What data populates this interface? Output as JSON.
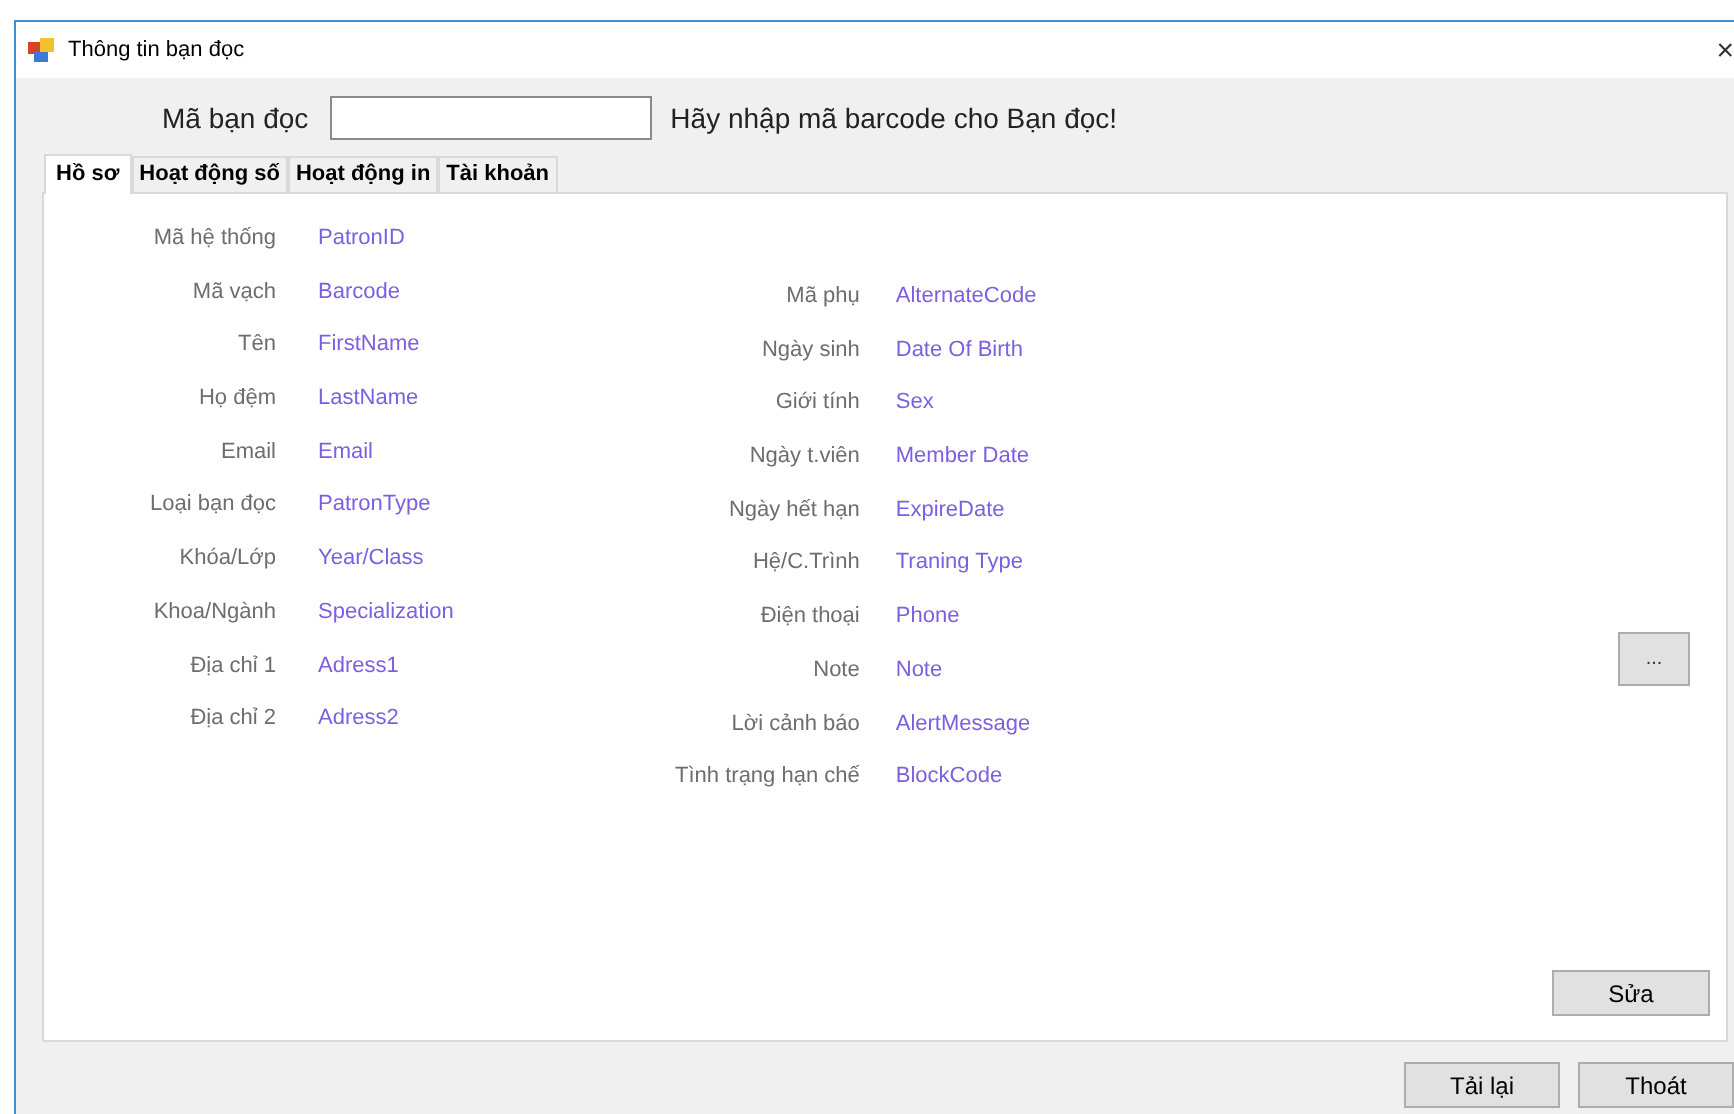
{
  "window": {
    "title": "Thông tin bạn đọc",
    "close": "×"
  },
  "lookup": {
    "label": "Mã bạn đọc",
    "hint": "Hãy nhập mã barcode cho Bạn đọc!"
  },
  "tabs": [
    {
      "label": "Hồ sơ",
      "selected": true
    },
    {
      "label": "Hoạt động số",
      "selected": false
    },
    {
      "label": "Hoạt động in",
      "selected": false
    },
    {
      "label": "Tài khoản",
      "selected": false
    }
  ],
  "left_fields": [
    {
      "label": "Mã hệ thống",
      "value": "PatronID"
    },
    {
      "label": "Mã vạch",
      "value": "Barcode"
    },
    {
      "label": "Tên",
      "value": "FirstName"
    },
    {
      "label": "Họ đệm",
      "value": "LastName"
    },
    {
      "label": "Email",
      "value": "Email"
    },
    {
      "label": "Loại bạn đọc",
      "value": "PatronType"
    },
    {
      "label": "Khóa/Lớp",
      "value": "Year/Class"
    },
    {
      "label": "Khoa/Ngành",
      "value": "Specialization"
    },
    {
      "label": "Địa chỉ 1",
      "value": "Adress1"
    },
    {
      "label": "Địa chỉ 2",
      "value": "Adress2"
    }
  ],
  "right_fields": [
    {
      "label": "Mã phụ",
      "value": "AlternateCode"
    },
    {
      "label": "Ngày sinh",
      "value": "Date Of Birth"
    },
    {
      "label": "Giới tính",
      "value": "Sex"
    },
    {
      "label": "Ngày t.viên",
      "value": "Member Date"
    },
    {
      "label": "Ngày hết hạn",
      "value": "ExpireDate"
    },
    {
      "label": "Hệ/C.Trình",
      "value": "Traning Type"
    },
    {
      "label": "Điện thoại",
      "value": "Phone"
    },
    {
      "label": "Note",
      "value": "Note"
    },
    {
      "label": "Lời cảnh báo",
      "value": "AlertMessage"
    },
    {
      "label": "Tình trạng hạn chế",
      "value": "BlockCode"
    }
  ],
  "browse_button": "...",
  "edit_button": "Sửa",
  "buttons": [
    "Tải lại",
    "Thoát"
  ]
}
